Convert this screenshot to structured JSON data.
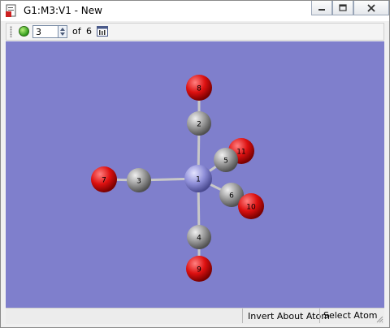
{
  "window": {
    "title": "G1:M3:V1 - New"
  },
  "toolbar": {
    "frame_value": "3",
    "of_label": "of",
    "total": "6"
  },
  "statusbar": {
    "invert_label": "Invert About Atom",
    "select_label": "Select Atom"
  },
  "molecule": {
    "colors": {
      "background": "#7f7fcc",
      "carbon": "#9a9a9a",
      "oxygen": "#dd1010",
      "metal": "#8e8ed8",
      "bond": "#c8c8c8"
    },
    "atoms": [
      {
        "label": "1",
        "element": "metal"
      },
      {
        "label": "2",
        "element": "carbon"
      },
      {
        "label": "3",
        "element": "carbon"
      },
      {
        "label": "4",
        "element": "carbon"
      },
      {
        "label": "5",
        "element": "carbon"
      },
      {
        "label": "6",
        "element": "carbon"
      },
      {
        "label": "7",
        "element": "oxygen"
      },
      {
        "label": "8",
        "element": "oxygen"
      },
      {
        "label": "9",
        "element": "oxygen"
      },
      {
        "label": "10",
        "element": "oxygen"
      },
      {
        "label": "11",
        "element": "oxygen"
      }
    ]
  }
}
